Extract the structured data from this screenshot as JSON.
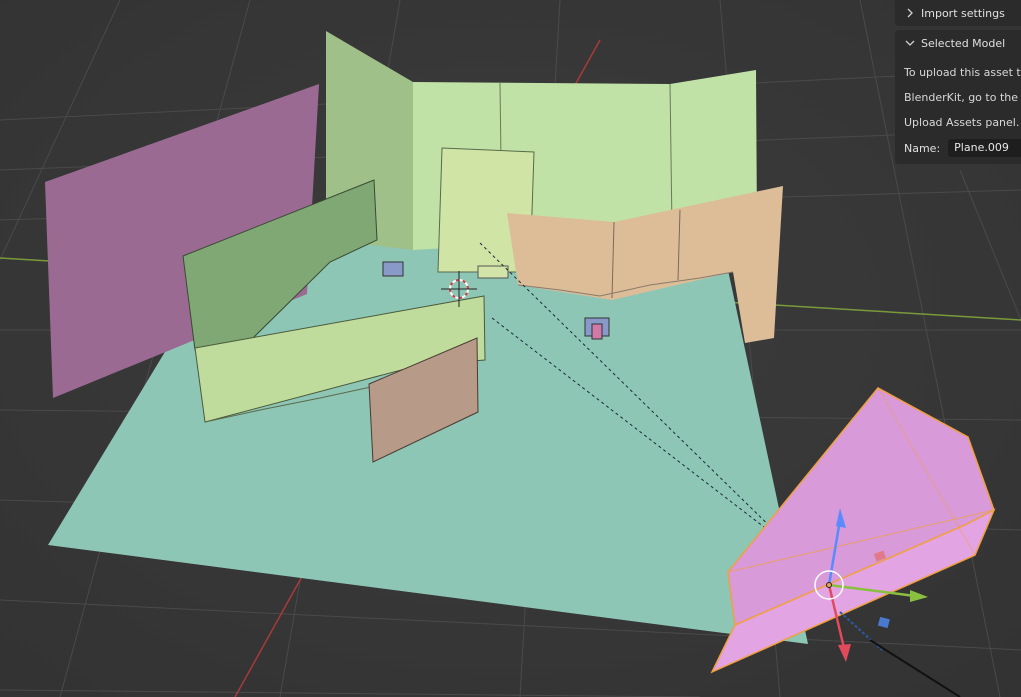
{
  "sidebar": {
    "import_settings": {
      "label": "Import settings",
      "icon": "chevron-right-icon"
    },
    "selected_model": {
      "label": "Selected Model",
      "icon": "chevron-down-icon",
      "lines": [
        "To upload this asset to",
        "BlenderKit, go to the Fi",
        "Upload Assets panel."
      ],
      "name_label": "Name:",
      "name_value": "Plane.009"
    }
  },
  "colors": {
    "background": "#3a3a3a",
    "grid_line": "#4a4a4a",
    "x_axis": "#a83a3a",
    "y_axis": "#7a9a3a",
    "floor": "#8ec6b6",
    "wall_green": "#bfe0a4",
    "wall_green_dark": "#7fa874",
    "wall_pink": "#9b6a93",
    "wall_orange": "#d8b894",
    "wall_brown": "#b79a88",
    "camera": "#e2a0e0",
    "selection_outline": "#f0a040"
  }
}
